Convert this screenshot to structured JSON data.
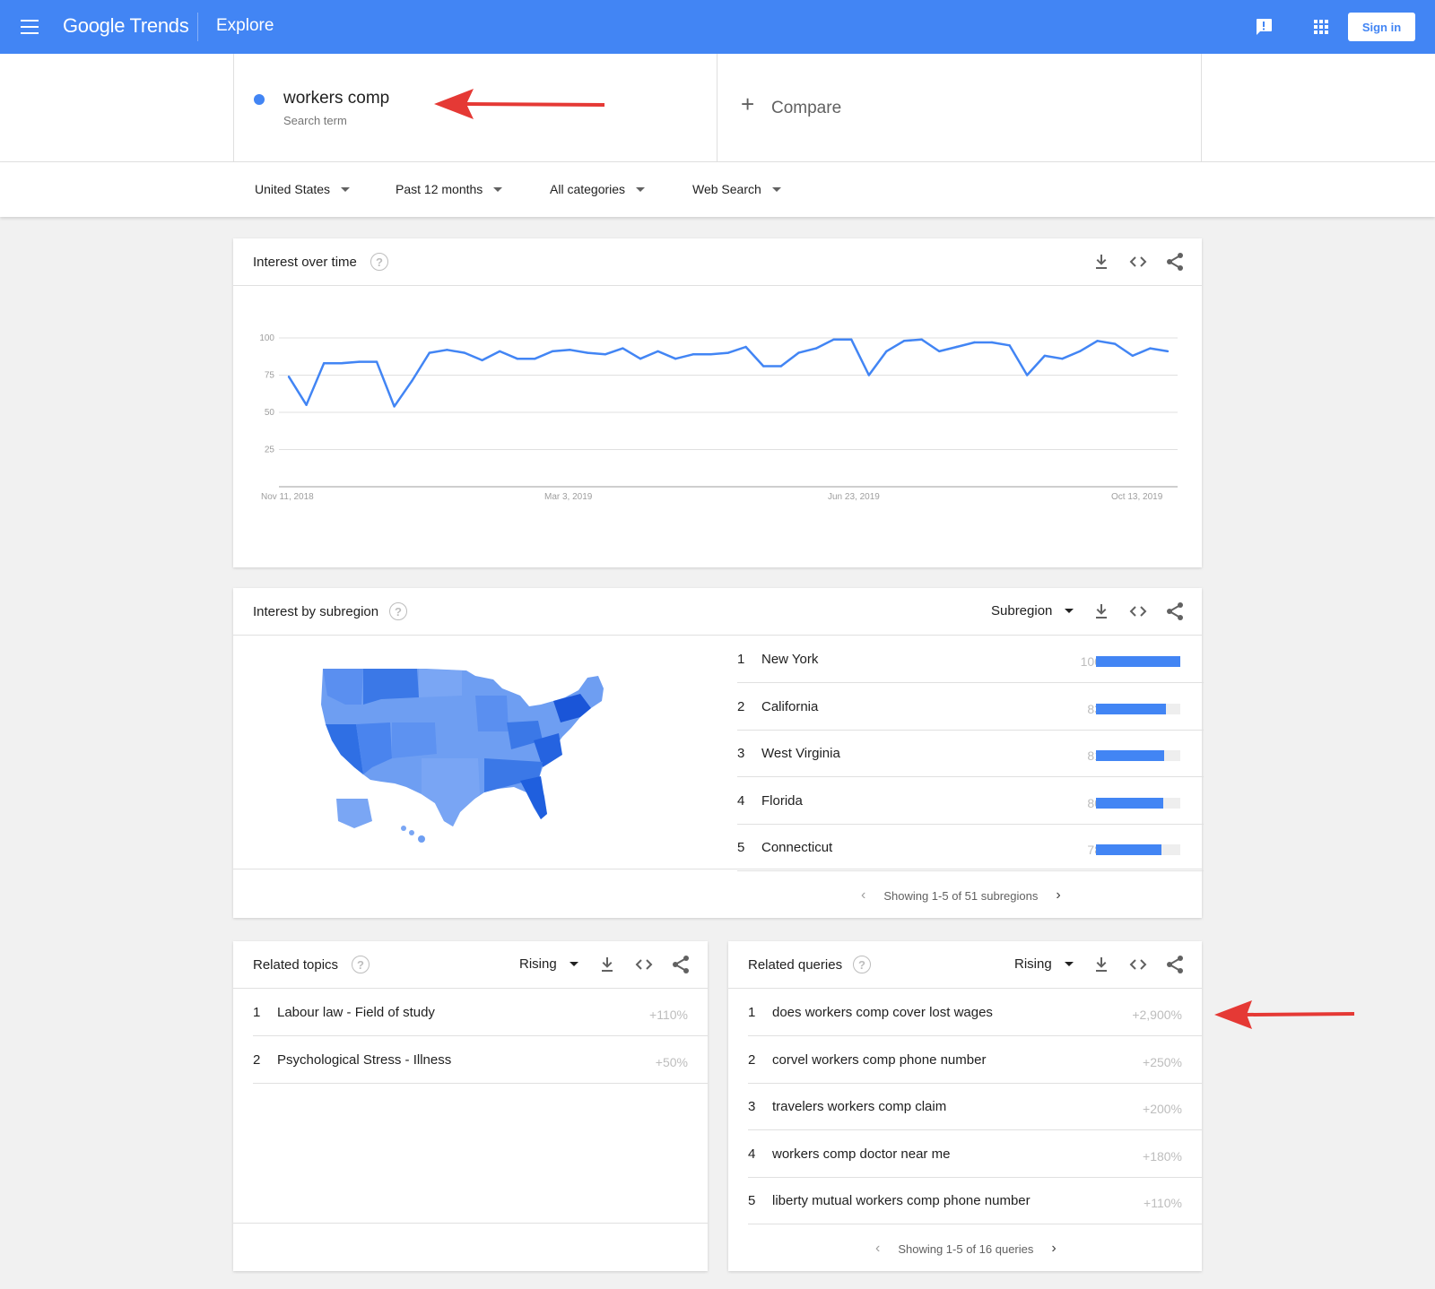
{
  "header": {
    "logo": "Google Trends",
    "section": "Explore",
    "sign_in": "Sign in"
  },
  "search": {
    "term": "workers comp",
    "term_type": "Search term",
    "compare_label": "Compare"
  },
  "filters": [
    {
      "label": "United States"
    },
    {
      "label": "Past 12 months"
    },
    {
      "label": "All categories"
    },
    {
      "label": "Web Search"
    }
  ],
  "interest_over_time": {
    "title": "Interest over time",
    "chart_data": {
      "type": "line",
      "title": "",
      "xlabel": "",
      "ylabel": "",
      "ylim": [
        0,
        100
      ],
      "yticks": [
        25,
        50,
        75,
        100
      ],
      "x_tick_labels": [
        "Nov 11, 2018",
        "Mar 3, 2019",
        "Jun 23, 2019",
        "Oct 13, 2019"
      ],
      "grid": true,
      "series": [
        {
          "color": "#4285f4",
          "values": [
            74,
            55,
            83,
            83,
            84,
            84,
            54,
            71,
            90,
            92,
            90,
            85,
            91,
            86,
            86,
            91,
            92,
            90,
            89,
            93,
            86,
            91,
            86,
            89,
            89,
            90,
            94,
            81,
            81,
            90,
            93,
            99,
            99,
            75,
            91,
            98,
            99,
            91,
            94,
            97,
            97,
            95,
            75,
            88,
            86,
            91,
            98,
            96,
            88,
            93,
            91
          ]
        }
      ]
    }
  },
  "interest_by_subregion": {
    "title": "Interest by subregion",
    "selector": "Subregion",
    "pager": "Showing 1-5 of 51 subregions",
    "rows": [
      {
        "rank": "1",
        "name": "New York",
        "value": "100",
        "fraction": 1.0
      },
      {
        "rank": "2",
        "name": "California",
        "value": "83",
        "fraction": 0.83
      },
      {
        "rank": "3",
        "name": "West Virginia",
        "value": "81",
        "fraction": 0.81
      },
      {
        "rank": "4",
        "name": "Florida",
        "value": "80",
        "fraction": 0.8
      },
      {
        "rank": "5",
        "name": "Connecticut",
        "value": "78",
        "fraction": 0.78
      }
    ]
  },
  "related_topics": {
    "title": "Related topics",
    "selector": "Rising",
    "rows": [
      {
        "rank": "1",
        "name": "Labour law - Field of study",
        "value": "+110%"
      },
      {
        "rank": "2",
        "name": "Psychological Stress - Illness",
        "value": "+50%"
      }
    ]
  },
  "related_queries": {
    "title": "Related queries",
    "selector": "Rising",
    "pager": "Showing 1-5 of 16 queries",
    "rows": [
      {
        "rank": "1",
        "name": "does workers comp cover lost wages",
        "value": "+2,900%"
      },
      {
        "rank": "2",
        "name": "corvel workers comp phone number",
        "value": "+250%"
      },
      {
        "rank": "3",
        "name": "travelers workers comp claim",
        "value": "+200%"
      },
      {
        "rank": "4",
        "name": "workers comp doctor near me",
        "value": "+180%"
      },
      {
        "rank": "5",
        "name": "liberty mutual workers comp phone number",
        "value": "+110%"
      }
    ]
  },
  "colors": {
    "brand": "#4285f4",
    "annotation_arrow": "#e53935"
  }
}
